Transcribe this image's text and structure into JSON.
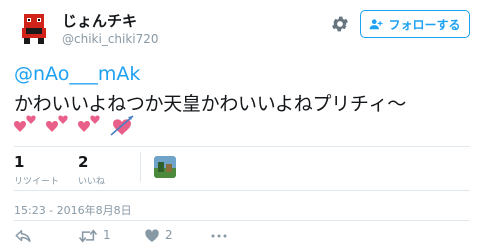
{
  "user": {
    "display_name": "じょんチキ",
    "handle": "@chiki_chiki720"
  },
  "follow_button": {
    "label": "フォローする"
  },
  "tweet": {
    "mention": "@nAo___mAk",
    "text": "かわいいよねつか天皇かわいいよねプリチィ〜",
    "emoji": [
      "two-hearts",
      "two-hearts",
      "two-hearts",
      "heart-with-arrow"
    ]
  },
  "stats": {
    "retweets": {
      "count": "1",
      "label": "リツイート"
    },
    "likes": {
      "count": "2",
      "label": "いいね"
    }
  },
  "timestamp": "15:23 - 2016年8月8日",
  "actions": {
    "retweet_count": "1",
    "like_count": "2"
  },
  "colors": {
    "accent": "#1da1f2",
    "muted": "#8899a6",
    "heart": "#e8608a"
  }
}
